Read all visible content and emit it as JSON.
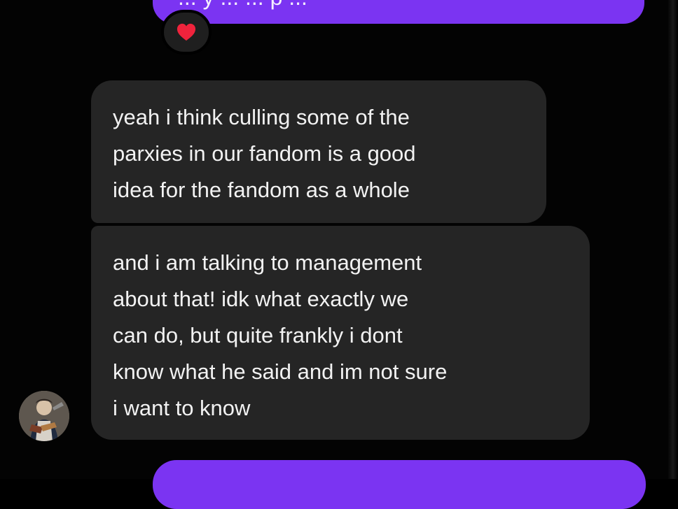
{
  "conversation": {
    "top_sent_message_partial": "... y ... ... p ...",
    "reaction": {
      "icon": "red-heart-icon",
      "color": "#ef233c"
    },
    "received_messages": [
      {
        "lines": [
          "yeah i think culling some of the",
          "parxies in our fandom is a good",
          "idea for the fandom as a whole"
        ]
      },
      {
        "lines": [
          "and i am talking to management",
          "about that! idk what exactly we",
          "can do, but quite frankly i dont",
          "know what he said and im not sure",
          "i want to know"
        ]
      }
    ],
    "avatar": {
      "icon": "profile-avatar-icon"
    }
  },
  "colors": {
    "background": "#030303",
    "received_bubble": "#252525",
    "sent_bubble": "#7b34f2",
    "text_primary": "#f2f2f2"
  }
}
